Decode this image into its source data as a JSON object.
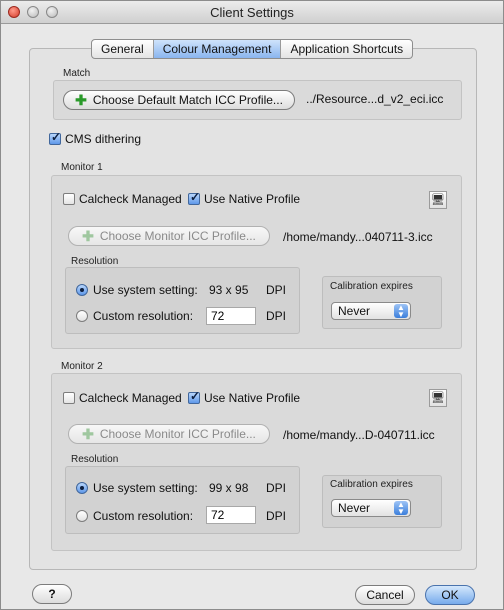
{
  "window": {
    "title": "Client Settings"
  },
  "tabs": [
    {
      "label": "General",
      "active": false
    },
    {
      "label": "Colour Management",
      "active": true
    },
    {
      "label": "Application Shortcuts",
      "active": false
    }
  ],
  "match": {
    "group_label": "Match",
    "button_label": "Choose Default Match ICC Profile...",
    "path": "../Resource...d_v2_eci.icc"
  },
  "cms_dithering": {
    "label": "CMS dithering",
    "checked": true
  },
  "monitors": [
    {
      "group_label": "Monitor 1",
      "calcheck_label": "Calcheck Managed",
      "calcheck_checked": false,
      "native_label": "Use Native Profile",
      "native_checked": true,
      "choose_button_label": "Choose Monitor ICC Profile...",
      "path": "/home/mandy...040711-3.icc",
      "resolution_label": "Resolution",
      "system_label": "Use system setting:",
      "system_value": "93 x 95",
      "dpi_label": "DPI",
      "custom_label": "Custom resolution:",
      "custom_value": "72",
      "custom_dpi_label": "DPI",
      "calibration_label": "Calibration expires",
      "calibration_value": "Never"
    },
    {
      "group_label": "Monitor 2",
      "calcheck_label": "Calcheck Managed",
      "calcheck_checked": false,
      "native_label": "Use Native Profile",
      "native_checked": true,
      "choose_button_label": "Choose Monitor ICC Profile...",
      "path": "/home/mandy...D-040711.icc",
      "resolution_label": "Resolution",
      "system_label": "Use system setting:",
      "system_value": "99 x 98",
      "dpi_label": "DPI",
      "custom_label": "Custom resolution:",
      "custom_value": "72",
      "custom_dpi_label": "DPI",
      "calibration_label": "Calibration expires",
      "calibration_value": "Never"
    }
  ],
  "footer": {
    "help_label": "?",
    "cancel_label": "Cancel",
    "ok_label": "OK"
  },
  "icons": {
    "monitor_identify": "monitor-icon",
    "help": "help-icon"
  },
  "colors": {
    "accent": "#77abec",
    "plus_green": "#2a9a2a"
  }
}
